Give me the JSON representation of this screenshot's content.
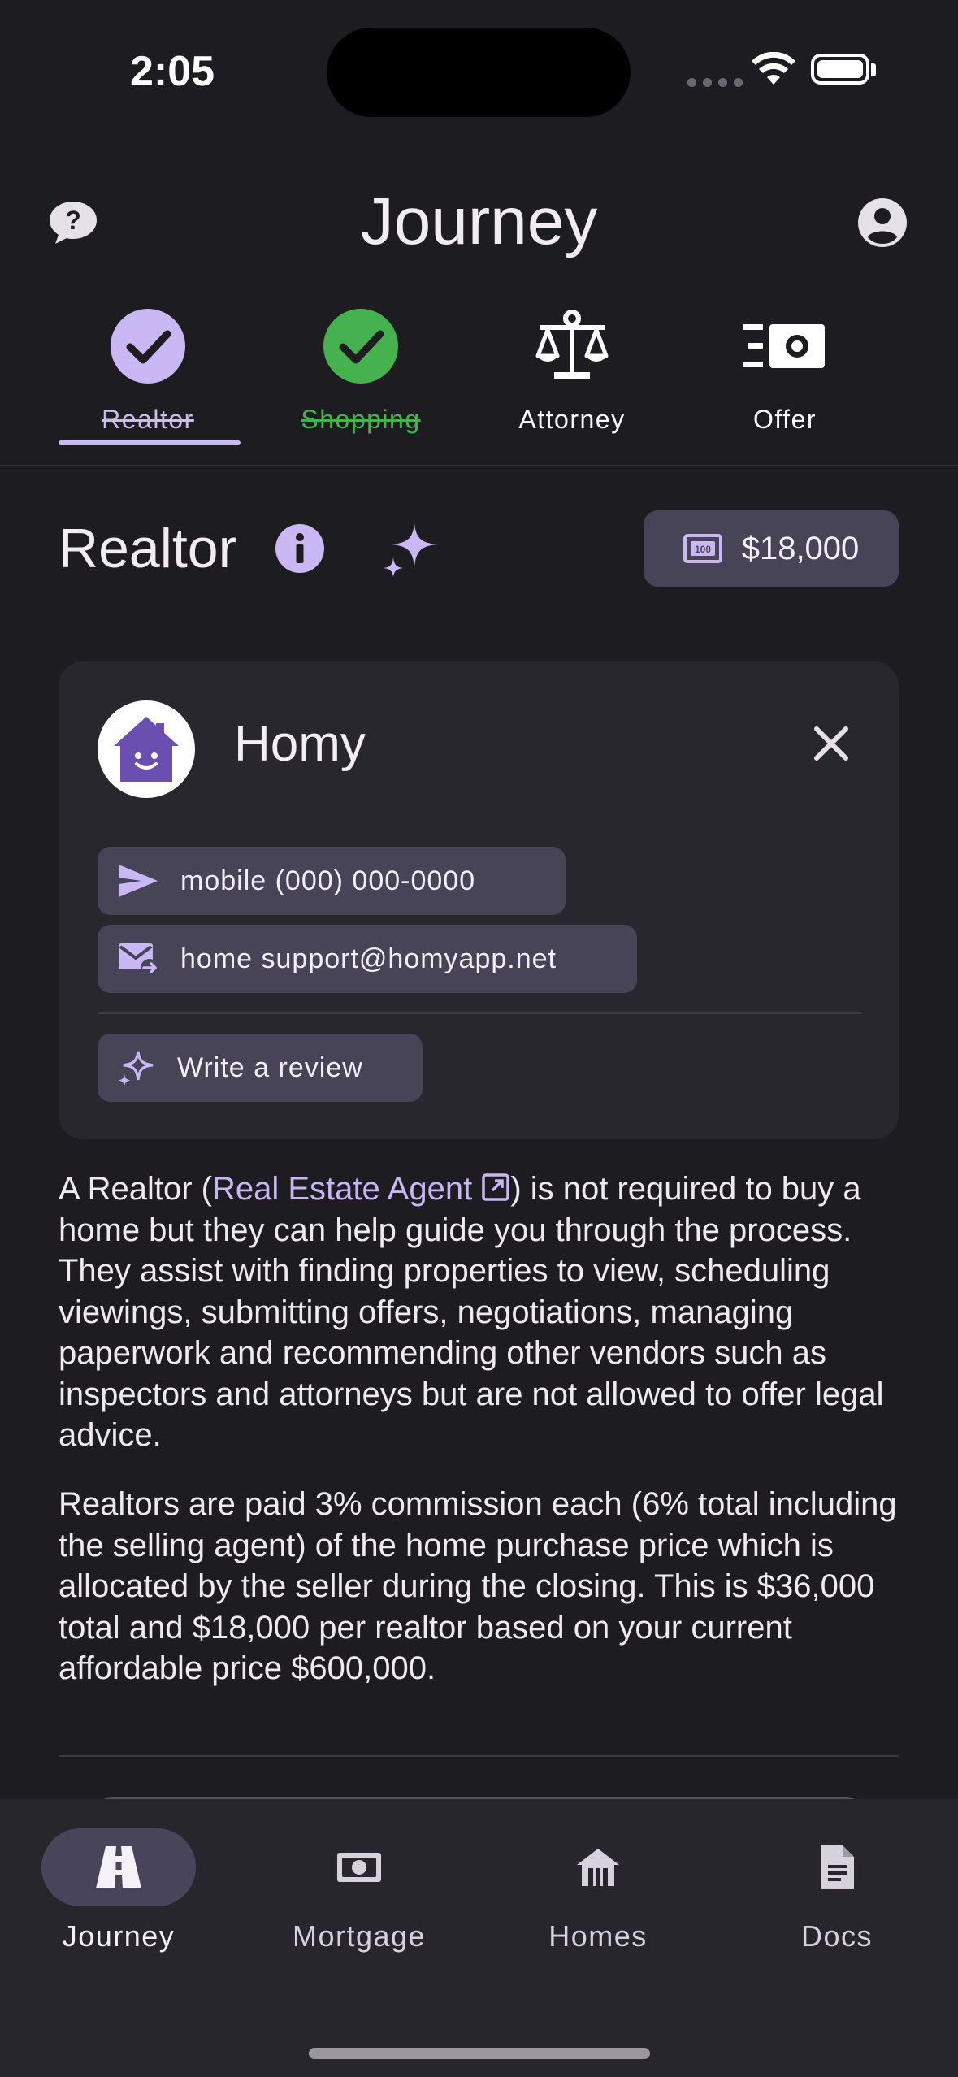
{
  "status_bar": {
    "time": "2:05"
  },
  "header": {
    "title": "Journey"
  },
  "steps": [
    {
      "label": "Realtor",
      "state": "current-complete"
    },
    {
      "label": "Shopping",
      "state": "complete"
    },
    {
      "label": "Attorney",
      "state": "pending"
    },
    {
      "label": "Offer",
      "state": "pending"
    }
  ],
  "section": {
    "title": "Realtor",
    "amount": "$18,000"
  },
  "vendor": {
    "name": "Homy",
    "phone_label": "mobile (000) 000-0000",
    "email_label": "home support@homyapp.net",
    "review_label": "Write a review"
  },
  "description": {
    "p1_start": "A Realtor (",
    "p1_link": "Real Estate Agent",
    "p1_end": ") is not required to buy a home but they can help guide you through the process. They assist with finding properties to view, scheduling viewings, submitting offers, negotiations, managing paperwork and recommending other vendors such as inspectors and attorneys but are not allowed to offer legal advice.",
    "p2": "Realtors are paid 3% commission each (6% total including the selling agent) of the home purchase price which is allocated by the seller during the closing. This is $36,000 total and $18,000 per realtor based on your current affordable price $600,000."
  },
  "bottom_nav": [
    {
      "label": "Journey",
      "active": true
    },
    {
      "label": "Mortgage",
      "active": false
    },
    {
      "label": "Homes",
      "active": false
    },
    {
      "label": "Docs",
      "active": false
    }
  ],
  "colors": {
    "background": "#1d1c20",
    "accent": "#c9b8f3",
    "success": "#46b24f",
    "chip": "#474458"
  }
}
